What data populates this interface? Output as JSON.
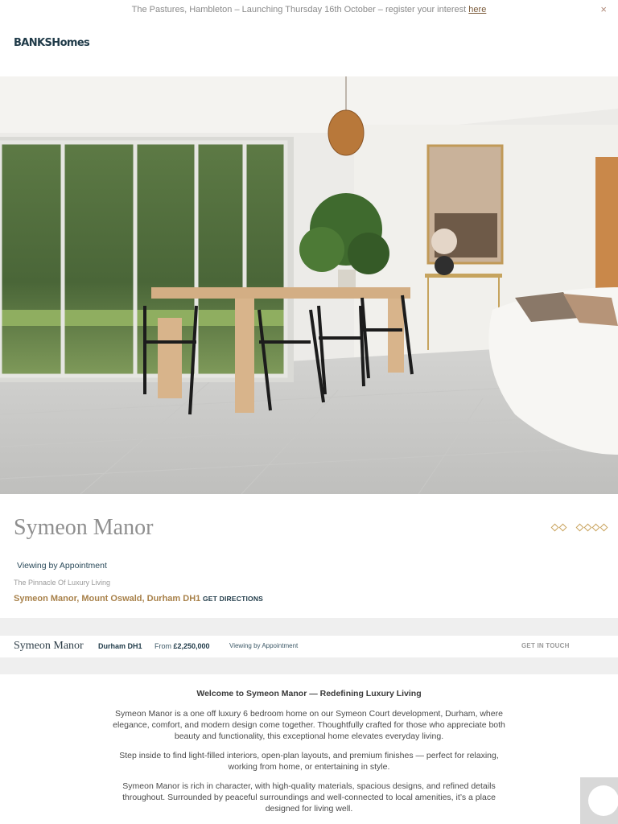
{
  "announcement": {
    "text": "The Pastures, Hambleton – Launching Thursday 16th October – register your interest",
    "link_text": "here",
    "close_glyph": "×"
  },
  "header": {
    "logo_text": "BANKSHomes"
  },
  "hero": {
    "image_alt": "Open-plan dining room with herringbone floor, bi-fold doors and wooden dining table"
  },
  "property": {
    "title": "Symeon Manor",
    "viewing": "Viewing by Appointment",
    "tagline": "The Pinnacle Of Luxury Living",
    "address": "Symeon Manor, Mount Oswald, Durham DH1",
    "directions_label": "GET DIRECTIONS"
  },
  "info_bar": {
    "name": "Symeon Manor",
    "location": "Durham DH1",
    "from_label": "From",
    "price": "£2,250,000",
    "viewing": "Viewing by Appointment",
    "cta": "GET IN TOUCH"
  },
  "content": {
    "heading": "Welcome to Symeon Manor — Redefining Luxury Living",
    "paragraphs": [
      "Symeon Manor is a one off luxury 6 bedroom home on our Symeon Court development, Durham, where elegance, comfort, and modern design come together. Thoughtfully crafted for those who appreciate both beauty and functionality, this exceptional home elevates everyday living.",
      "Step inside to find light-filled interiors, open-plan layouts, and premium finishes — perfect for relaxing, working from home, or entertaining in style.",
      "Symeon Manor is rich in character, with high-quality materials, spacious designs, and refined details throughout. Surrounded by peaceful surroundings and well-connected to local amenities, it’s a place designed for living well."
    ]
  },
  "colors": {
    "brand_navy": "#1f3a48",
    "accent_gold": "#a8814a",
    "band_grey": "#efefef"
  }
}
